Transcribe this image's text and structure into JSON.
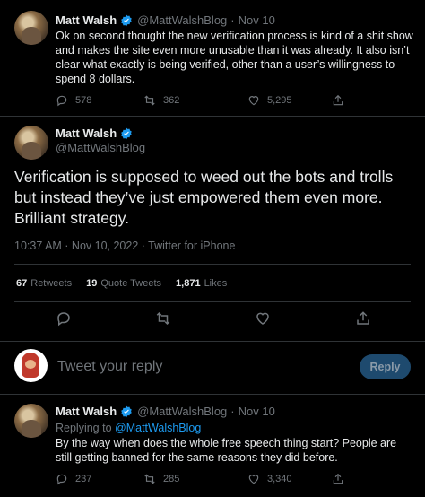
{
  "tweet1": {
    "name": "Matt Walsh",
    "handle": "@MattWalshBlog",
    "dot": "·",
    "date": "Nov 10",
    "text": "Ok on second thought the new verification process is kind of a shit show and makes the site even more unusable than it was already. It also isn’t clear what exactly is being verified, other than a user’s willingness to spend 8 dollars.",
    "replies": "578",
    "retweets": "362",
    "likes": "5,295"
  },
  "main": {
    "name": "Matt Walsh",
    "handle": "@MattWalshBlog",
    "text": "Verification is supposed to weed out the bots and trolls but instead they’ve just empowered them even more. Brilliant strategy.",
    "meta": "10:37 AM · Nov 10, 2022 · Twitter for iPhone",
    "retweets_count": "67",
    "retweets_label": "Retweets",
    "quotes_count": "19",
    "quotes_label": "Quote Tweets",
    "likes_count": "1,871",
    "likes_label": "Likes"
  },
  "reply_box": {
    "placeholder": "Tweet your reply",
    "button": "Reply"
  },
  "tweet3": {
    "name": "Matt Walsh",
    "handle": "@MattWalshBlog",
    "dot": "·",
    "date": "Nov 10",
    "replying_prefix": "Replying to",
    "replying_to": "@MattWalshBlog",
    "text": "By the way when does the whole free speech thing start? People are still getting banned for the same reasons they did before.",
    "replies": "237",
    "retweets": "285",
    "likes": "3,340"
  },
  "colors": {
    "accent": "#1d9bf0",
    "muted": "#71767b",
    "divider": "#2f3336",
    "background": "#000000"
  }
}
